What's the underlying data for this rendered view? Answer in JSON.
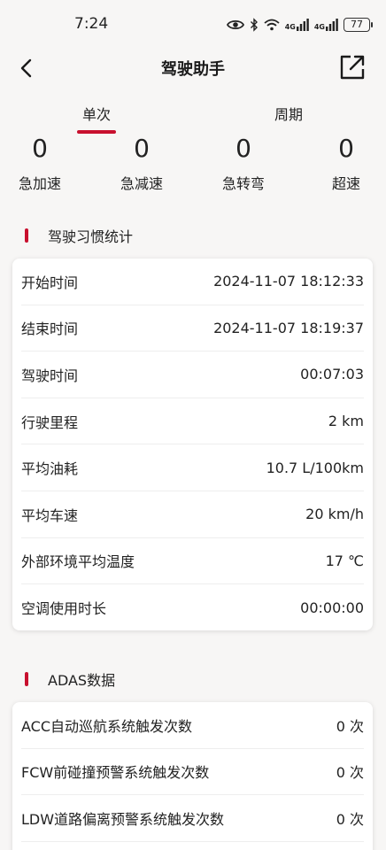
{
  "status_bar": {
    "time": "7:24",
    "battery": "77",
    "network_1": "4G",
    "network_2": "4G"
  },
  "header": {
    "title": "驾驶助手"
  },
  "tabs": [
    {
      "label": "单次"
    },
    {
      "label": "周期"
    }
  ],
  "counters": [
    {
      "value": "0",
      "label": "急加速"
    },
    {
      "value": "0",
      "label": "急减速"
    },
    {
      "value": "0",
      "label": "急转弯"
    },
    {
      "value": "0",
      "label": "超速"
    }
  ],
  "habits": {
    "title": "驾驶习惯统计",
    "rows": [
      {
        "label": "开始时间",
        "value": "2024-11-07 18:12:33"
      },
      {
        "label": "结束时间",
        "value": "2024-11-07 18:19:37"
      },
      {
        "label": "驾驶时间",
        "value": "00:07:03"
      },
      {
        "label": "行驶里程",
        "value": "2 km"
      },
      {
        "label": "平均油耗",
        "value": "10.7 L/100km"
      },
      {
        "label": "平均车速",
        "value": "20 km/h"
      },
      {
        "label": "外部环境平均温度",
        "value": "17 ℃"
      },
      {
        "label": "空调使用时长",
        "value": "00:00:00"
      }
    ]
  },
  "adas": {
    "title": "ADAS数据",
    "rows": [
      {
        "label": "ACC自动巡航系统触发次数",
        "value": "0 次"
      },
      {
        "label": "FCW前碰撞预警系统触发次数",
        "value": "0 次"
      },
      {
        "label": "LDW道路偏离预警系统触发次数",
        "value": "0 次"
      }
    ]
  },
  "colors": {
    "accent": "#c8102e",
    "background": "#f7f6f5",
    "card": "#ffffff"
  }
}
